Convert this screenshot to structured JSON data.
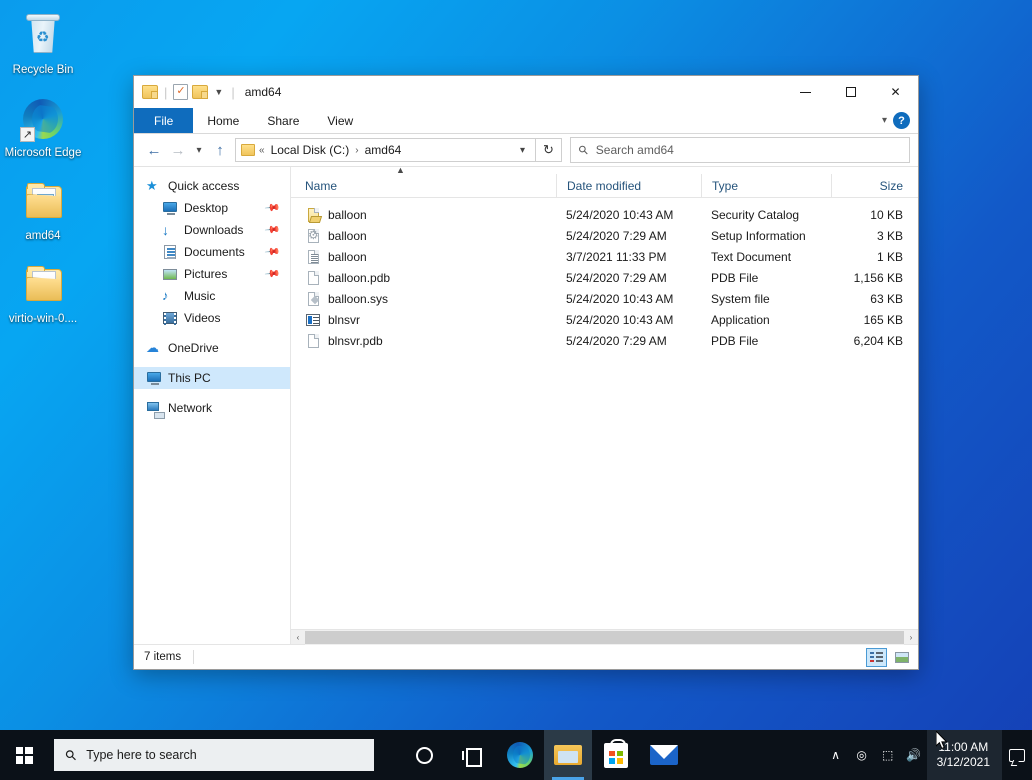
{
  "desktop": {
    "icons": [
      {
        "label": "Recycle Bin",
        "icon": "recycle-bin-icon"
      },
      {
        "label": "Microsoft Edge",
        "icon": "microsoft-edge-icon"
      },
      {
        "label": "amd64",
        "icon": "folder-icon"
      },
      {
        "label": "virtio-win-0....",
        "icon": "folder-icon"
      }
    ]
  },
  "window": {
    "title": "amd64",
    "quick_access": {
      "folder_icon": "folder-icon",
      "properties_icon": "properties-icon",
      "new_folder_icon": "new-folder-icon",
      "dropdown_icon": "chevron-down-icon"
    },
    "controls": {
      "minimize": "minimize-icon",
      "maximize": "maximize-icon",
      "close": "close-icon"
    },
    "ribbon": {
      "tabs": [
        "File",
        "Home",
        "Share",
        "View"
      ],
      "active_tab": "File",
      "collapse_icon": "chevron-down-icon",
      "help_label": "?"
    },
    "address": {
      "back_icon": "arrow-left-icon",
      "forward_icon": "arrow-right-icon",
      "recent_icon": "chevron-down-icon",
      "up_icon": "arrow-up-icon",
      "overflow": "«",
      "crumbs": [
        "Local Disk (C:)",
        "amd64"
      ],
      "separator": "›",
      "dropdown_icon": "chevron-down-icon",
      "refresh_icon": "refresh-icon"
    },
    "search": {
      "placeholder": "Search amd64",
      "icon": "search-icon"
    },
    "sidebar": {
      "items": [
        {
          "label": "Quick access",
          "icon": "star-icon",
          "indent": false,
          "pinned": false,
          "selected": false
        },
        {
          "label": "Desktop",
          "icon": "desktop-icon",
          "indent": true,
          "pinned": true,
          "selected": false
        },
        {
          "label": "Downloads",
          "icon": "downloads-icon",
          "indent": true,
          "pinned": true,
          "selected": false
        },
        {
          "label": "Documents",
          "icon": "documents-icon",
          "indent": true,
          "pinned": true,
          "selected": false
        },
        {
          "label": "Pictures",
          "icon": "pictures-icon",
          "indent": true,
          "pinned": true,
          "selected": false
        },
        {
          "label": "Music",
          "icon": "music-icon",
          "indent": true,
          "pinned": false,
          "selected": false
        },
        {
          "label": "Videos",
          "icon": "videos-icon",
          "indent": true,
          "pinned": false,
          "selected": false
        },
        {
          "label": "OneDrive",
          "icon": "onedrive-icon",
          "indent": false,
          "pinned": false,
          "selected": false
        },
        {
          "label": "This PC",
          "icon": "this-pc-icon",
          "indent": false,
          "pinned": false,
          "selected": true
        },
        {
          "label": "Network",
          "icon": "network-icon",
          "indent": false,
          "pinned": false,
          "selected": false
        }
      ]
    },
    "filelist": {
      "columns": [
        "Name",
        "Date modified",
        "Type",
        "Size"
      ],
      "sort_column": "Name",
      "sort_direction": "ascending",
      "rows": [
        {
          "name": "balloon",
          "date": "5/24/2020 10:43 AM",
          "type": "Security Catalog",
          "size": "10 KB",
          "icon": "security-catalog-icon"
        },
        {
          "name": "balloon",
          "date": "5/24/2020 7:29 AM",
          "type": "Setup Information",
          "size": "3 KB",
          "icon": "setup-information-icon"
        },
        {
          "name": "balloon",
          "date": "3/7/2021 11:33 PM",
          "type": "Text Document",
          "size": "1 KB",
          "icon": "text-document-icon"
        },
        {
          "name": "balloon.pdb",
          "date": "5/24/2020 7:29 AM",
          "type": "PDB File",
          "size": "1,156 KB",
          "icon": "generic-file-icon"
        },
        {
          "name": "balloon.sys",
          "date": "5/24/2020 10:43 AM",
          "type": "System file",
          "size": "63 KB",
          "icon": "system-file-icon"
        },
        {
          "name": "blnsvr",
          "date": "5/24/2020 10:43 AM",
          "type": "Application",
          "size": "165 KB",
          "icon": "application-icon"
        },
        {
          "name": "blnsvr.pdb",
          "date": "5/24/2020 7:29 AM",
          "type": "PDB File",
          "size": "6,204 KB",
          "icon": "generic-file-icon"
        }
      ]
    },
    "statusbar": {
      "item_count": "7 items",
      "details_view_label": "details-view",
      "tiles_view_label": "large-icons-view",
      "active_view": "details-view"
    },
    "scrollbar": {
      "left_arrow": "‹",
      "right_arrow": "›"
    }
  },
  "taskbar": {
    "start_label": "windows-logo",
    "search_placeholder": "Type here to search",
    "search_icon": "search-icon",
    "apps": [
      {
        "name": "cortana-icon",
        "active": false
      },
      {
        "name": "task-view-icon",
        "active": false
      },
      {
        "name": "microsoft-edge-icon",
        "active": false
      },
      {
        "name": "file-explorer-icon",
        "active": true
      },
      {
        "name": "microsoft-store-icon",
        "active": false
      },
      {
        "name": "mail-icon",
        "active": false
      }
    ],
    "tray": [
      {
        "name": "show-hidden-icons-chevron",
        "glyph": "∧"
      },
      {
        "name": "camera-icon",
        "glyph": "◎"
      },
      {
        "name": "network-icon",
        "glyph": "⬚"
      },
      {
        "name": "volume-icon",
        "glyph": "🔊"
      }
    ],
    "clock": {
      "time": "11:00 AM",
      "date": "3/12/2021"
    },
    "action_center": "action-center-icon"
  },
  "colors": {
    "accent": "#0f6cbd",
    "selection": "#cfe8fc",
    "taskbar": "#0b1118",
    "folder": "#f0c45c",
    "close_hover": "#e81123"
  }
}
